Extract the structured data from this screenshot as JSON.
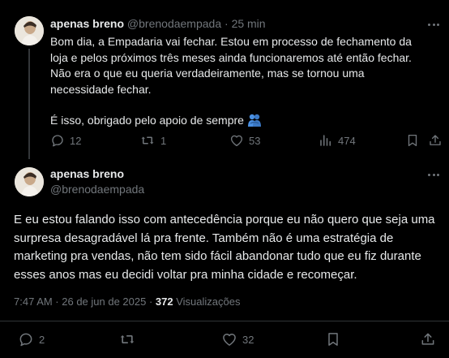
{
  "tweet1": {
    "author_name": "apenas breno",
    "author_handle": "@brenodaempada",
    "separator": "·",
    "time_ago": "25 min",
    "body_p1": "Bom dia, a Empadaria vai fechar. Estou em processo de fechamento da loja e pelos próximos três meses ainda funcionaremos até então fechar. Não era o que eu queria verdadeiramente, mas se tornou uma necessidade fechar.",
    "body_p2": "É isso, obrigado pelo apoio de sempre",
    "emoji": "🫂",
    "replies": "12",
    "reposts": "1",
    "likes": "53",
    "views": "474"
  },
  "tweet2": {
    "author_name": "apenas breno",
    "author_handle": "@brenodaempada",
    "body": "E eu estou falando isso com antecedência porque eu não quero que seja uma surpresa desagradável lá pra frente. Também não é uma estratégia de marketing pra vendas, não tem sido fácil abandonar tudo que eu fiz durante esses anos mas eu decidi voltar pra minha cidade e recomeçar.",
    "timestamp": "7:47 AM · 26 de jun de 2025 · ",
    "views_count": "372",
    "views_label": " Visualizações",
    "replies": "2",
    "likes": "32"
  },
  "colors": {
    "background": "#000000",
    "text_primary": "#e7e9ea",
    "text_muted": "#71767b",
    "divider": "#2f3336",
    "emoji_blue": "#4a90e2"
  },
  "icons": [
    "more-icon",
    "reply-icon",
    "repost-icon",
    "like-icon",
    "views-icon",
    "bookmark-icon",
    "share-icon",
    "hug-emoji"
  ]
}
